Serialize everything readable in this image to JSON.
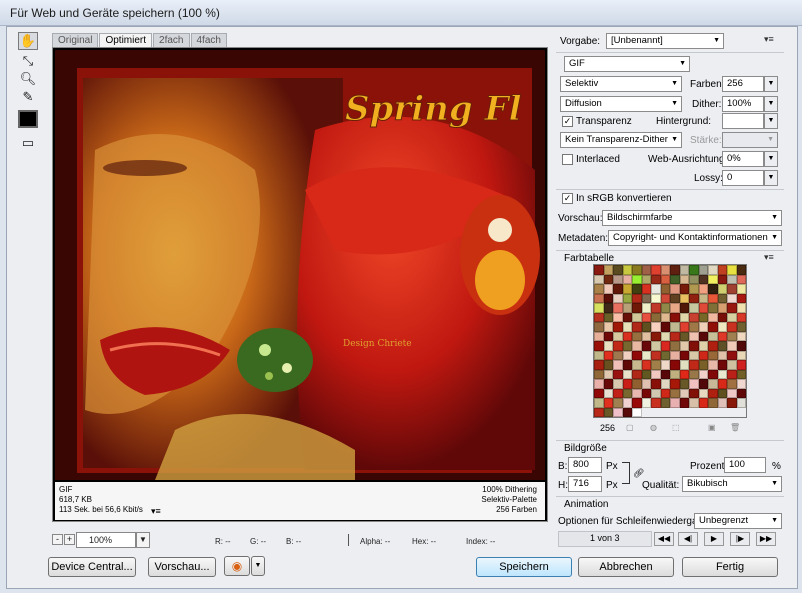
{
  "window": {
    "title": "Für Web und Geräte speichern (100 %)"
  },
  "tools": {
    "hand": "hand-icon",
    "slice_select": "slice-select-icon",
    "zoom": "zoom-icon",
    "eyedropper": "eyedropper-icon",
    "color": "#000000",
    "toggle": "slice-visibility-icon"
  },
  "tabs": [
    "Original",
    "Optimiert",
    "2fach",
    "4fach"
  ],
  "preview": {
    "artwork_title": "Spring Fl",
    "watermark": "Design Chriete",
    "info_left": [
      "GIF",
      "618,7 KB",
      "113 Sek. bei 56,6 Kbit/s"
    ],
    "info_right": [
      "100% Dithering",
      "Selektiv-Palette",
      "256 Farben"
    ],
    "info_menu": "▾≡"
  },
  "statusbar": {
    "zoom_minus": "-",
    "zoom_plus": "+",
    "zoom": "100%",
    "r": "R: --",
    "g": "G: --",
    "b": "B: --",
    "alpha": "Alpha: --",
    "hex": "Hex: --",
    "index": "Index: --"
  },
  "buttons": {
    "device_central": "Device Central...",
    "preview": "Vorschau...",
    "save": "Speichern",
    "cancel": "Abbrechen",
    "done": "Fertig"
  },
  "settings": {
    "preset_label": "Vorgabe:",
    "preset": "[Unbenannt]",
    "format": "GIF",
    "reduction": "Selektiv",
    "colors_label": "Farben:",
    "colors": "256",
    "dither_algo": "Diffusion",
    "dither_label": "Dither:",
    "dither": "100%",
    "transparency": "Transparenz",
    "matte_label": "Hintergrund:",
    "transparency_dither": "Kein Transparenz-Dither",
    "amount_label": "Stärke:",
    "interlaced": "Interlaced",
    "websnap_label": "Web-Ausrichtung:",
    "websnap": "0%",
    "lossy_label": "Lossy:",
    "lossy": "0",
    "srgb": "In sRGB konvertieren",
    "preview_label": "Vorschau:",
    "preview": "Bildschirmfarbe",
    "metadata_label": "Metadaten:",
    "metadata": "Copyright- und Kontaktinformationen"
  },
  "color_table": {
    "title": "Farbtabelle",
    "count": "256",
    "colors": [
      "#8a1a10",
      "#c2a060",
      "#5a4a20",
      "#c8c840",
      "#8a7a20",
      "#a06048",
      "#e04030",
      "#d89070",
      "#602010",
      "#c0b8a0",
      "#38781a",
      "#a0a090",
      "#e0d8c0",
      "#c04020",
      "#e8e040",
      "#4a2a10",
      "#d8c8b0",
      "#702810",
      "#b89888",
      "#e8b0a0",
      "#98f030",
      "#b0a868",
      "#982818",
      "#d86040",
      "#406028",
      "#d8b890",
      "#909060",
      "#503020",
      "#f0f060",
      "#881810",
      "#c0c0b0",
      "#e06858",
      "#a88048",
      "#f0c8b8",
      "#601808",
      "#c8a830",
      "#404010",
      "#d83020",
      "#e8e8e0",
      "#906030",
      "#e09880",
      "#781a0a",
      "#b09850",
      "#f0a080",
      "#302010",
      "#d0d070",
      "#a04030",
      "#f0e8a0",
      "#c87050",
      "#581008",
      "#e8d0c0",
      "#98a840",
      "#b02818",
      "#806850",
      "#f8f8d0",
      "#d04838",
      "#604020",
      "#e8c060",
      "#902010",
      "#c8b888",
      "#e85838",
      "#706030",
      "#f0d8d0",
      "#a81810",
      "#d8e060",
      "#402818",
      "#e87060",
      "#b8a078",
      "#701808",
      "#f0f0c8",
      "#c03828",
      "#908848",
      "#e8a888",
      "#501808",
      "#c8c8a0",
      "#e04838",
      "#807038",
      "#d8a070",
      "#981810",
      "#f0e0b0",
      "#b83020",
      "#686028",
      "#f8c0a8",
      "#681008",
      "#d0c898",
      "#e85040",
      "#8a6a38",
      "#e0b890",
      "#881008",
      "#e0d8a8",
      "#c84030",
      "#786828",
      "#f0b8a0",
      "#781008",
      "#d8d0a0",
      "#d83828",
      "#906840",
      "#e8c8a8",
      "#a01808",
      "#e8e0b8",
      "#b02818",
      "#605020",
      "#f8d0c0",
      "#600808",
      "#c0b890",
      "#e04030",
      "#a07848",
      "#f0d0b8",
      "#901008",
      "#f0e8c0",
      "#c83020",
      "#706030",
      "#e8b098",
      "#700808",
      "#d8c8a0",
      "#d83020",
      "#987040",
      "#e0c0a0",
      "#881808",
      "#e0d8b0",
      "#b82818",
      "#685828",
      "#f0c0b0",
      "#580808",
      "#c8c098",
      "#e03828",
      "#a08050",
      "#f0d8c0",
      "#981008",
      "#e8e0c0",
      "#c02818",
      "#786830",
      "#e8b8a0",
      "#680808",
      "#d0c8a0",
      "#d82820",
      "#907040",
      "#e0c8a8",
      "#801008",
      "#e0d0a8",
      "#b02010",
      "#605028",
      "#f0c8b8",
      "#500808",
      "#c0b888",
      "#e03020",
      "#a07850",
      "#f0d0c0",
      "#900808",
      "#e8e8c8",
      "#c03020",
      "#706830",
      "#e8b0a0",
      "#780808",
      "#d8c8a8",
      "#d02818",
      "#986838",
      "#e0c0a8",
      "#901010",
      "#e8d8b8",
      "#a82010",
      "#685020",
      "#f0c0b8",
      "#600808",
      "#c8b890",
      "#d83020",
      "#a08048",
      "#f0d8c8",
      "#880808",
      "#e0e0c0",
      "#c02818",
      "#786028",
      "#e8b8a8",
      "#700808",
      "#d0c0a0",
      "#d02020",
      "#906838",
      "#e0c8b0",
      "#981010",
      "#e8e0c8",
      "#b02818",
      "#605820",
      "#f0c8c0",
      "#580808",
      "#c0b080",
      "#e02818",
      "#987848",
      "#f0d0c8",
      "#800808",
      "#e8e8d0",
      "#b82018",
      "#706028",
      "#e8b0a8",
      "#680808",
      "#d8c8b0",
      "#c82018",
      "#906030",
      "#e0c0b0",
      "#881008",
      "#e0d8c0",
      "#a81808",
      "#685828",
      "#f0c0c0",
      "#500808",
      "#c8b898",
      "#d82818",
      "#a07040",
      "#f0d8d0",
      "#900808",
      "#e8e0d0",
      "#c02018",
      "#786830",
      "#e8b8b0",
      "#780808",
      "#d0c8b0",
      "#d02818",
      "#987040",
      "#e0c8b8",
      "#801008",
      "#e8d8c0",
      "#b02010",
      "#605020",
      "#f0c8c8",
      "#600808",
      "#c0b888",
      "#e03020",
      "#a08050",
      "#f0d0d0",
      "#980808",
      "#f0f0e0",
      "#c83020",
      "#706030",
      "#e8b0b0",
      "#700808",
      "#d8c0a8",
      "#d82818",
      "#906838",
      "#e0c0b8",
      "#881808",
      "#e0e0d8",
      "#b82818",
      "#685828",
      "#f0c0c8",
      "#580808",
      "#ffffff"
    ]
  },
  "image_size": {
    "title": "Bildgröße",
    "w_label": "B:",
    "w": "800",
    "h_label": "H:",
    "h": "716",
    "unit": "Px",
    "percent_label": "Prozent:",
    "percent": "100",
    "percent_unit": "%",
    "quality_label": "Qualität:",
    "quality": "Bikubisch"
  },
  "animation": {
    "title": "Animation",
    "loop_label": "Optionen für Schleifenwiedergabe:",
    "loop": "Unbegrenzt",
    "frame": "1 von 3"
  }
}
